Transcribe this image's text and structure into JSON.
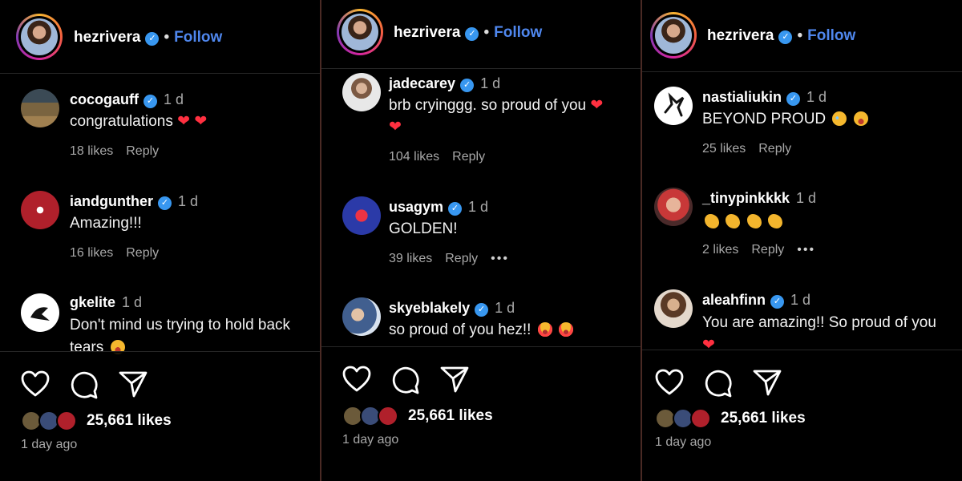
{
  "panels": [
    {
      "header": {
        "username": "hezrivera",
        "separator": "•",
        "follow_label": "Follow"
      },
      "comments": [
        {
          "username": "cocogauff",
          "time": "1 d",
          "text": "congratulations",
          "likes": "18 likes",
          "reply": "Reply",
          "avatar_color": "#6b5a3a"
        },
        {
          "username": "iandgunther",
          "time": "1 d",
          "text": "Amazing!!!",
          "likes": "16 likes",
          "reply": "Reply",
          "avatar_color": "#b0202b"
        },
        {
          "username": "gkelite",
          "time": "1 d",
          "text": "Don't mind us trying to hold back",
          "text2": "tears",
          "avatar_color": "#ffffff"
        }
      ],
      "footer": {
        "likes": "25,661 likes",
        "ago": "1 day ago"
      }
    },
    {
      "header": {
        "username": "hezrivera",
        "separator": "•",
        "follow_label": "Follow"
      },
      "comments": [
        {
          "username": "jadecarey",
          "time": "1 d",
          "text": "brb cryinggg. so proud of you",
          "likes": "104 likes",
          "reply": "Reply",
          "avatar_color": "#c9c9c9"
        },
        {
          "username": "usagym",
          "time": "1 d",
          "text": "GOLDEN!",
          "likes": "39 likes",
          "reply": "Reply",
          "more": "•••",
          "avatar_color": "#1e2a78"
        },
        {
          "username": "skyeblakely",
          "time": "1 d",
          "text": "so proud of you hez!!",
          "avatar_color": "#9ab4d6"
        }
      ],
      "footer": {
        "likes": "25,661 likes",
        "ago": "1 day ago"
      }
    },
    {
      "header": {
        "username": "hezrivera",
        "separator": "•",
        "follow_label": "Follow"
      },
      "comments": [
        {
          "username": "nastialiukin",
          "time": "1 d",
          "text": "BEYOND PROUD",
          "likes": "25 likes",
          "reply": "Reply",
          "avatar_color": "#ffffff"
        },
        {
          "username": "_tinypinkkkk",
          "time": "1 d",
          "text": "",
          "likes": "2 likes",
          "reply": "Reply",
          "more": "•••",
          "avatar_color": "#d24a4a"
        },
        {
          "username": "aleahfinn",
          "time": "1 d",
          "text": "You are amazing!! So proud of you",
          "avatar_color": "#c99c78"
        }
      ],
      "footer": {
        "likes": "25,661 likes",
        "ago": "1 day ago"
      }
    }
  ],
  "icons": {
    "verified": "verified-badge-icon",
    "heart": "heart-icon",
    "comment": "comment-icon",
    "share": "share-icon"
  },
  "colors": {
    "background": "#000000",
    "accent": "#4f87ee",
    "verified": "#3897f0",
    "muted": "#a8a8a8",
    "heart": "#ff3040"
  }
}
